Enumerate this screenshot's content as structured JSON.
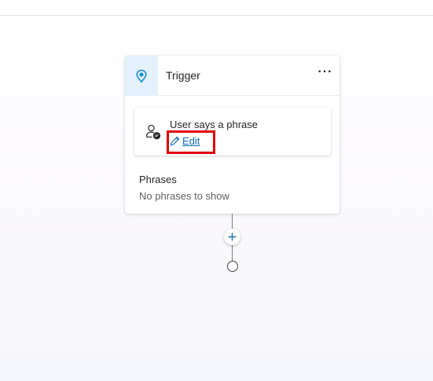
{
  "trigger_card": {
    "title": "Trigger",
    "more_label": "···",
    "phrase_box": {
      "title": "User says a phrase",
      "edit_label": "Edit"
    },
    "phrases": {
      "heading": "Phrases",
      "empty_text": "No phrases to show"
    }
  },
  "icons": {
    "trigger": "lightbulb-pin-icon",
    "user": "person-chat-icon",
    "edit": "pencil-icon",
    "add": "plus-icon"
  },
  "colors": {
    "accent": "#0f6cbd",
    "trigger_icon_bg": "#e3f1fb",
    "trigger_icon": "#1a8fd8",
    "highlight": "#e00000"
  }
}
